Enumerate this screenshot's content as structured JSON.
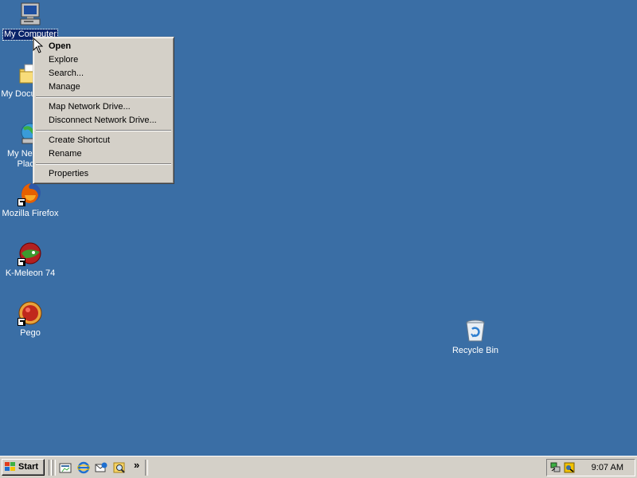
{
  "desktop": {
    "background": "#3a6ea5",
    "icons": [
      {
        "label": "My Computer",
        "icon": "computer-icon",
        "selected": true
      },
      {
        "label": "My Documents",
        "icon": "folder-icon"
      },
      {
        "label": "My Network Places",
        "icon": "network-icon"
      },
      {
        "label": "Mozilla Firefox",
        "icon": "firefox-icon",
        "shortcut": true
      },
      {
        "label": "K-Meleon 74",
        "icon": "kmeleon-icon",
        "shortcut": true
      },
      {
        "label": "Pego",
        "icon": "pego-icon",
        "shortcut": true
      },
      {
        "label": "Recycle Bin",
        "icon": "recycle-bin-icon"
      }
    ]
  },
  "context_menu": {
    "items": [
      {
        "label": "Open",
        "bold": true
      },
      {
        "label": "Explore"
      },
      {
        "label": "Search..."
      },
      {
        "label": "Manage"
      },
      {
        "label": "Map Network Drive..."
      },
      {
        "label": "Disconnect Network Drive..."
      },
      {
        "label": "Create Shortcut"
      },
      {
        "label": "Rename"
      },
      {
        "label": "Properties"
      }
    ]
  },
  "taskbar": {
    "start_label": "Start",
    "quick_launch": [
      "show-desktop-icon",
      "internet-explorer-icon",
      "outlook-express-icon",
      "search-icon"
    ],
    "overflow_label": "»",
    "clock": "9:07 AM",
    "tray_icons": [
      "network-status-icon",
      "volume-icon"
    ]
  }
}
